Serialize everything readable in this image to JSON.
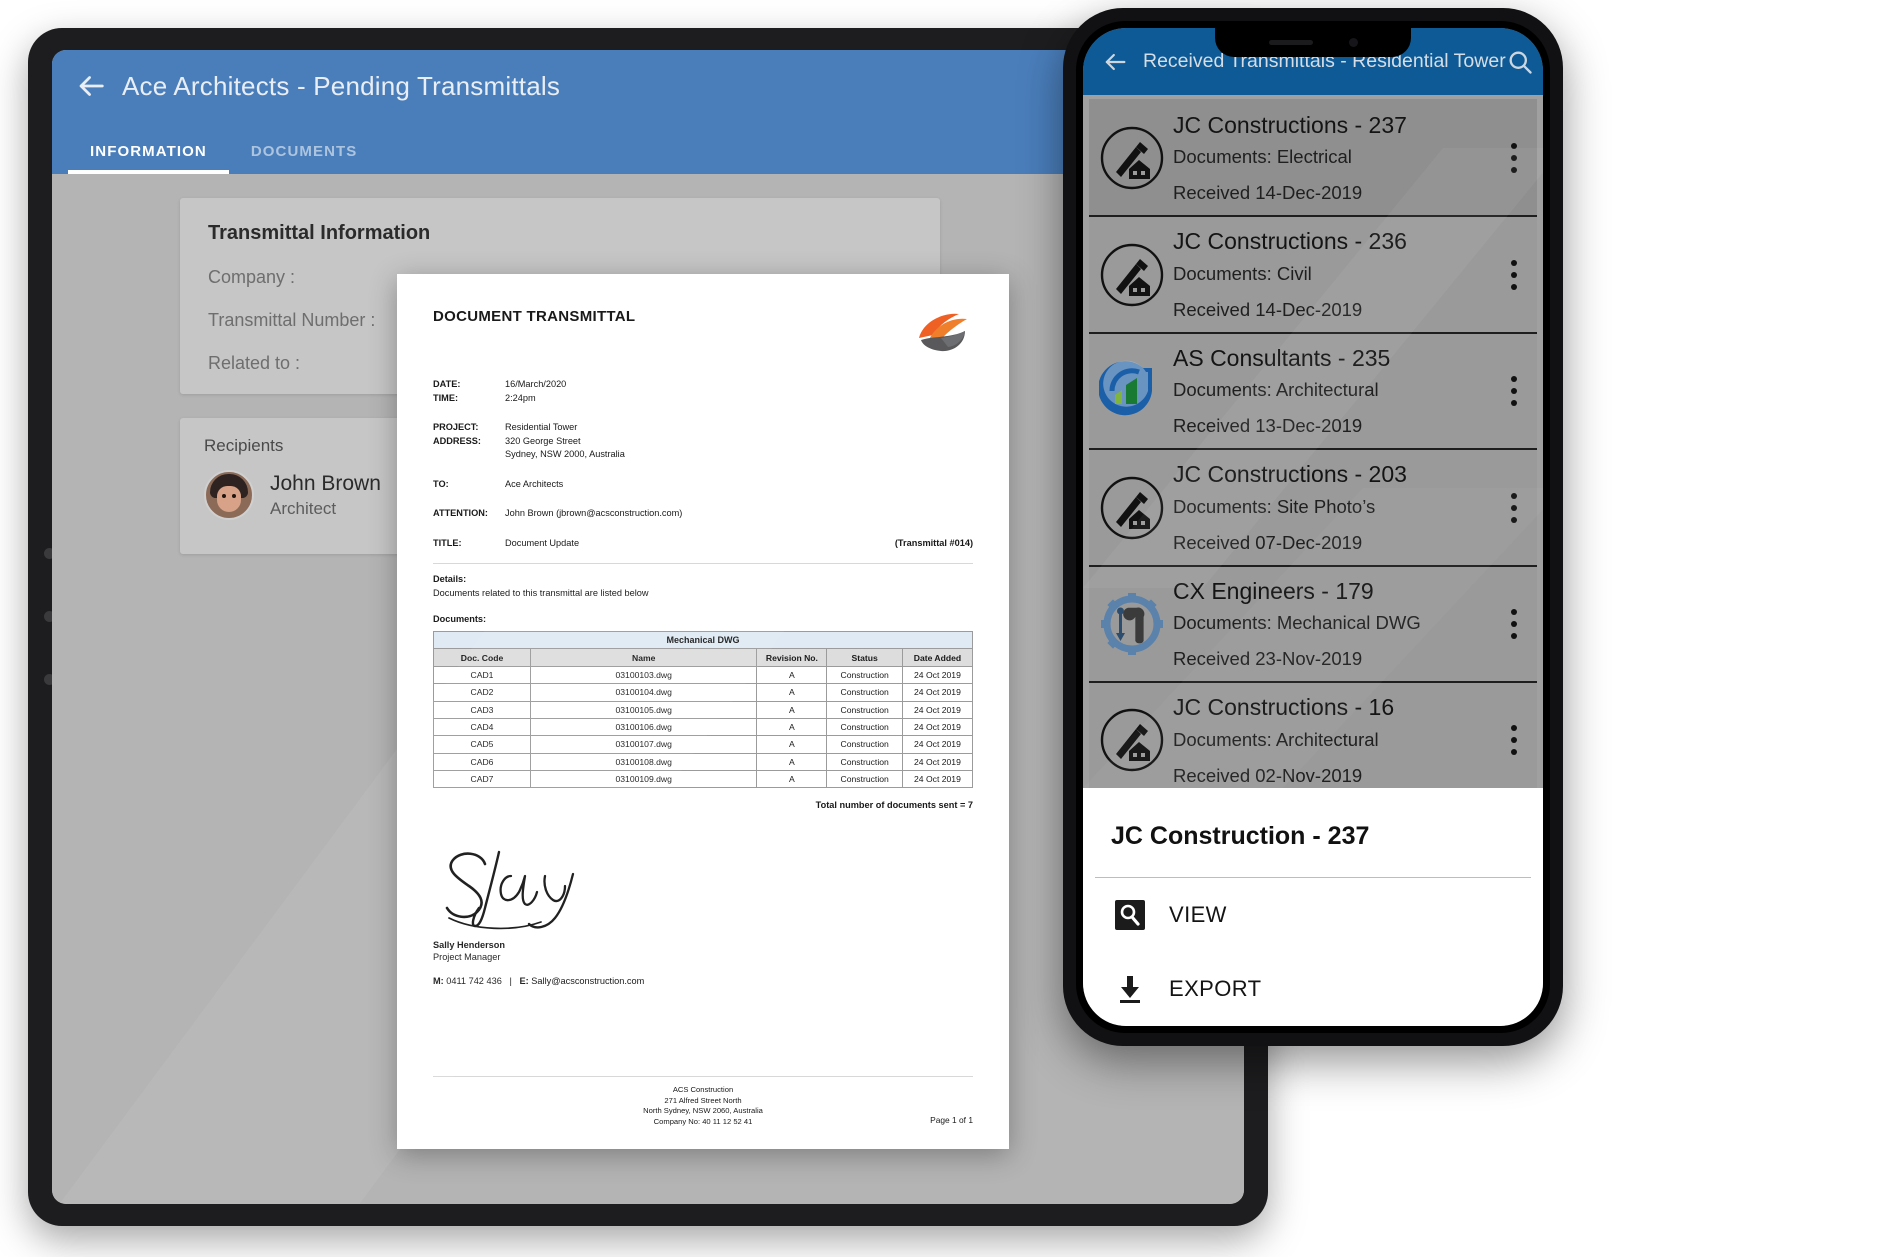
{
  "tablet": {
    "app_bar": {
      "back_icon": "arrow-left-icon",
      "title": "Ace Architects - Pending Transmittals"
    },
    "tabs": [
      {
        "label": "INFORMATION",
        "active": true
      },
      {
        "label": "DOCUMENTS",
        "active": false
      }
    ],
    "info_card": {
      "heading": "Transmittal Information",
      "rows": [
        "Company :",
        "Transmittal Number :",
        "Related to :"
      ]
    },
    "recipients_card": {
      "heading": "Recipients",
      "person": {
        "name": "John Brown",
        "role": "Architect",
        "avatar_icon": "avatar"
      }
    }
  },
  "document": {
    "title": "DOCUMENT TRANSMITTAL",
    "logo_icon": "acs-construction-logo",
    "meta": [
      {
        "key": "DATE:",
        "value": "16/March/2020"
      },
      {
        "key": "TIME:",
        "value": "2:24pm"
      }
    ],
    "project": [
      {
        "key": "PROJECT:",
        "value": "Residential Tower"
      },
      {
        "key": "ADDRESS:",
        "value": "320 George Street"
      },
      {
        "key": "",
        "value": "Sydney, NSW 2000, Australia"
      }
    ],
    "to": {
      "key": "TO:",
      "value": "Ace Architects"
    },
    "attention": {
      "key": "ATTENTION:",
      "value": "John Brown (jbrown@acsconstruction.com)"
    },
    "title_row": {
      "key": "TITLE:",
      "value": "Document Update",
      "transmittal_no": "(Transmittal #014)"
    },
    "details_label": "Details:",
    "details_text": "Documents related to this transmittal are listed below",
    "documents_label": "Documents:",
    "table": {
      "group_header": "Mechanical DWG",
      "columns": [
        "Doc. Code",
        "Name",
        "Revision No.",
        "Status",
        "Date Added"
      ],
      "rows": [
        [
          "CAD1",
          "03100103.dwg",
          "A",
          "Construction",
          "24 Oct 2019"
        ],
        [
          "CAD2",
          "03100104.dwg",
          "A",
          "Construction",
          "24 Oct 2019"
        ],
        [
          "CAD3",
          "03100105.dwg",
          "A",
          "Construction",
          "24 Oct 2019"
        ],
        [
          "CAD4",
          "03100106.dwg",
          "A",
          "Construction",
          "24 Oct 2019"
        ],
        [
          "CAD5",
          "03100107.dwg",
          "A",
          "Construction",
          "24 Oct 2019"
        ],
        [
          "CAD6",
          "03100108.dwg",
          "A",
          "Construction",
          "24 Oct 2019"
        ],
        [
          "CAD7",
          "03100109.dwg",
          "A",
          "Construction",
          "24 Oct 2019"
        ]
      ]
    },
    "total_text": "Total number of documents sent = 7",
    "signature": {
      "script_text": "Sally",
      "name": "Sally Henderson",
      "role": "Project Manager",
      "mobile_label": "M:",
      "mobile": "0411 742 436",
      "separator": "|",
      "email_label": "E:",
      "email": "Sally@acsconstruction.com"
    },
    "footer": {
      "lines": [
        "ACS Construction",
        "271 Alfred Street North",
        "North Sydney, NSW 2060, Australia",
        "Company No: 40 11 12 52 41"
      ],
      "page": "Page 1 of 1"
    }
  },
  "phone": {
    "app_bar": {
      "back_icon": "arrow-left-icon",
      "title": "Received Transmittals - Residential Tower",
      "search_icon": "search-icon"
    },
    "list": [
      {
        "title": "JC Constructions - 237",
        "subtitle": "Documents: Electrical",
        "date": "Received 14-Dec-2019",
        "icon": "hammer-house-icon"
      },
      {
        "title": "JC Constructions - 236",
        "subtitle": "Documents: Civil",
        "date": "Received 14-Dec-2019",
        "icon": "hammer-house-icon"
      },
      {
        "title": "AS Consultants - 235",
        "subtitle": "Documents: Architectural",
        "date": "Received 13-Dec-2019",
        "icon": "chart-arc-icon"
      },
      {
        "title": "JC Constructions - 203",
        "subtitle": "Documents: Site Photo’s",
        "date": "Received 07-Dec-2019",
        "icon": "hammer-house-icon"
      },
      {
        "title": "CX Engineers - 179",
        "subtitle": "Documents: Mechanical DWG",
        "date": "Received 23-Nov-2019",
        "icon": "gear-wrench-icon"
      },
      {
        "title": "JC Constructions - 16",
        "subtitle": "Documents: Architectural",
        "date": "Received 02-Nov-2019",
        "icon": "hammer-house-icon"
      }
    ],
    "kebab_icon": "more-vertical-icon",
    "sheet": {
      "title": "JC Construction - 237",
      "items": [
        {
          "label": "VIEW",
          "icon": "view-search-icon"
        },
        {
          "label": "EXPORT",
          "icon": "download-icon"
        }
      ]
    }
  },
  "colors": {
    "tablet_app_bar": "#4a7ebb",
    "phone_app_bar": "#0d5a96",
    "logo_orange": "#ef6024",
    "logo_grey": "#59595b"
  }
}
